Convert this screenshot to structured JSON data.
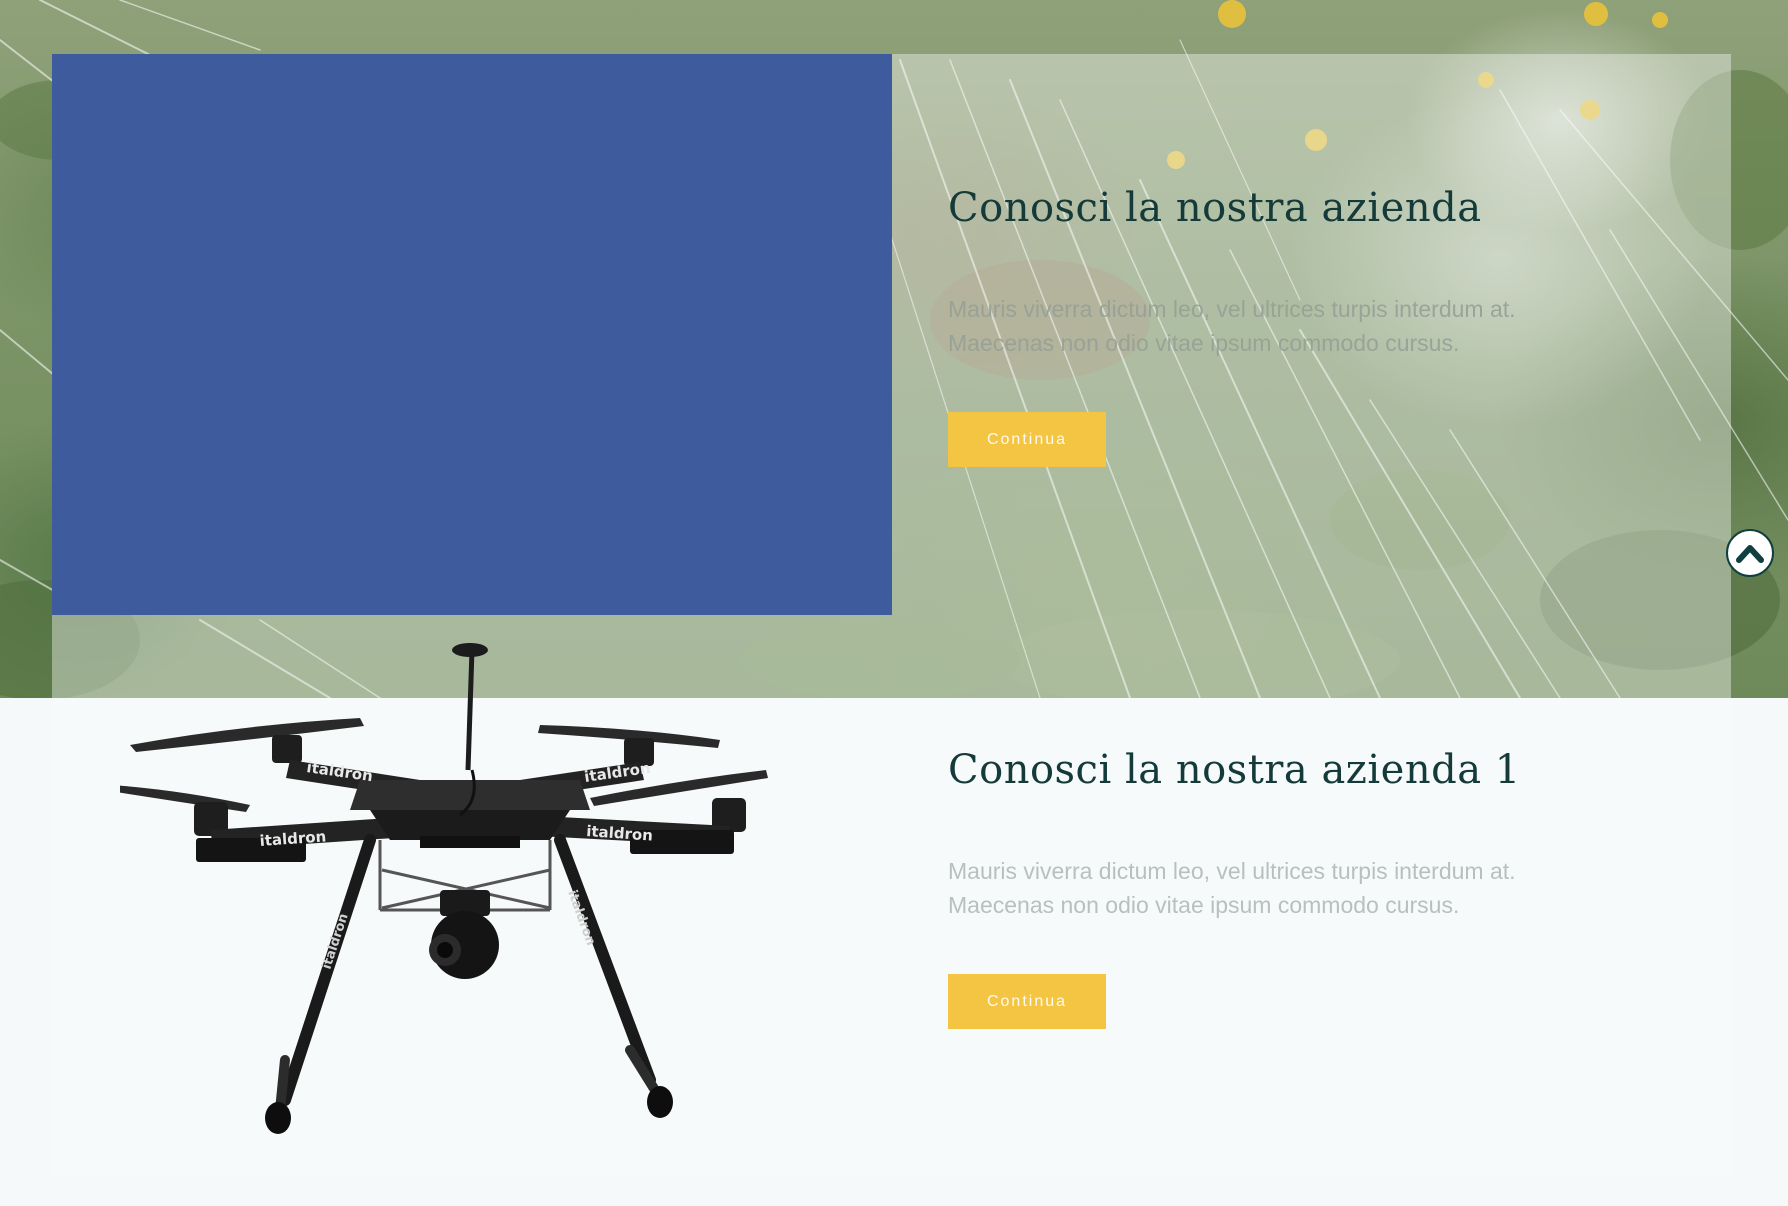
{
  "sections": [
    {
      "heading": "Conosci la nostra azienda",
      "body_line_1": "Mauris viverra dictum leo, vel ultrices turpis interdum at.",
      "body_line_2": "Maecenas non odio vitae ipsum commodo cursus.",
      "button_label": "Continua"
    },
    {
      "heading": "Conosci la nostra azienda 1",
      "body_line_1": "Mauris viverra dictum leo, vel ultrices turpis interdum at.",
      "body_line_2": "Maecenas non odio vitae ipsum commodo cursus.",
      "button_label": "Continua"
    }
  ],
  "drone": {
    "brand_text": "italdron"
  },
  "colors": {
    "accent_button": "#f4c443",
    "heading": "#143a3a",
    "blue_panel": "#3e5b9e"
  },
  "icons": {
    "scroll_top": "chevron-up-icon"
  }
}
